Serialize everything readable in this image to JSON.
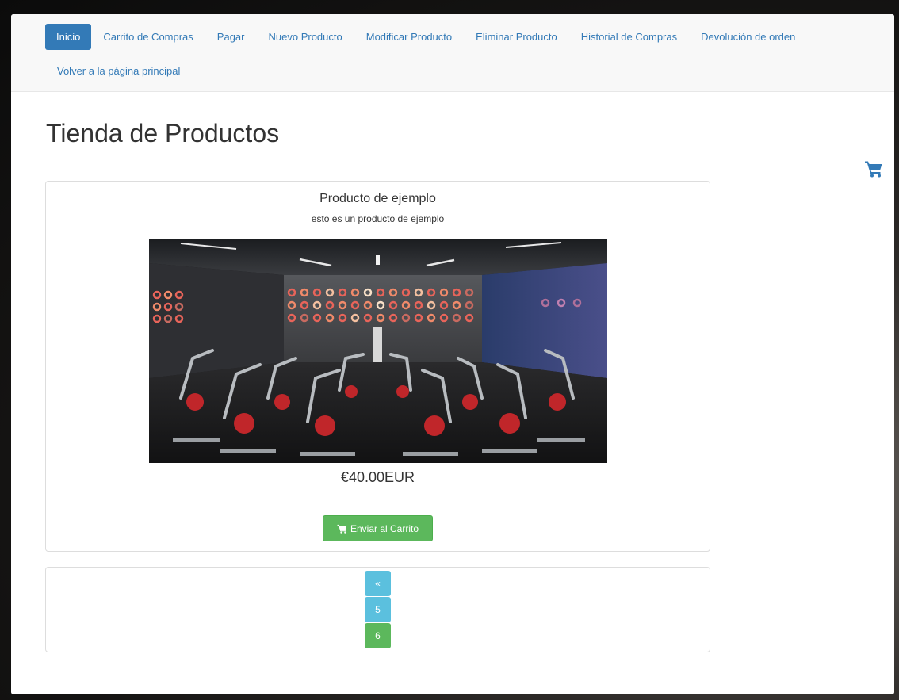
{
  "nav": {
    "items": [
      {
        "label": "Inicio",
        "active": true
      },
      {
        "label": "Carrito de Compras"
      },
      {
        "label": "Pagar"
      },
      {
        "label": "Nuevo Producto"
      },
      {
        "label": "Modificar Producto"
      },
      {
        "label": "Eliminar Producto"
      },
      {
        "label": "Historial de Compras"
      },
      {
        "label": "Devolución de orden"
      }
    ],
    "back_label": "Volver a la página principal"
  },
  "page": {
    "title": "Tienda de Productos",
    "cart_icon": "shopping-cart-icon"
  },
  "product": {
    "name": "Producto de ejemplo",
    "description": "esto es un producto de ejemplo",
    "image": "spinning-gym-room-image",
    "price": "€40.00EUR",
    "add_label": "Enviar al Carrito"
  },
  "pagination": {
    "prev_label": "«",
    "pages": [
      "5",
      "6"
    ],
    "current": "6"
  },
  "colors": {
    "primary": "#337ab7",
    "success": "#5cb85c",
    "info": "#5bc0de"
  }
}
